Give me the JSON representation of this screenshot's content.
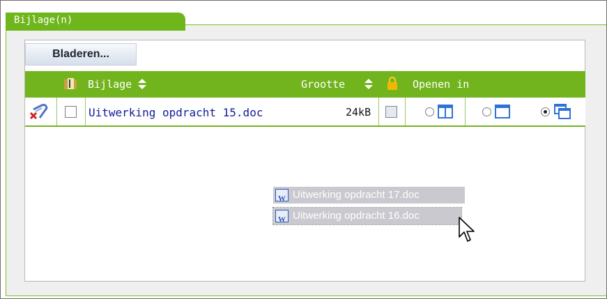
{
  "panel": {
    "tab_label": "Bijlage(n)",
    "browse_button": "Bladeren..."
  },
  "table": {
    "headers": {
      "name": "Bijlage",
      "size": "Grootte",
      "open_in": "Openen in"
    },
    "rows": [
      {
        "name": "Uitwerking opdracht 15.doc",
        "size": "24kB",
        "open_in_selected": "new-window"
      }
    ]
  },
  "drag": {
    "items": [
      "Uitwerking opdracht 17.doc",
      "Uitwerking opdracht 16.doc"
    ]
  },
  "colors": {
    "accent": "#72b41e",
    "link": "#0f1d9a"
  }
}
